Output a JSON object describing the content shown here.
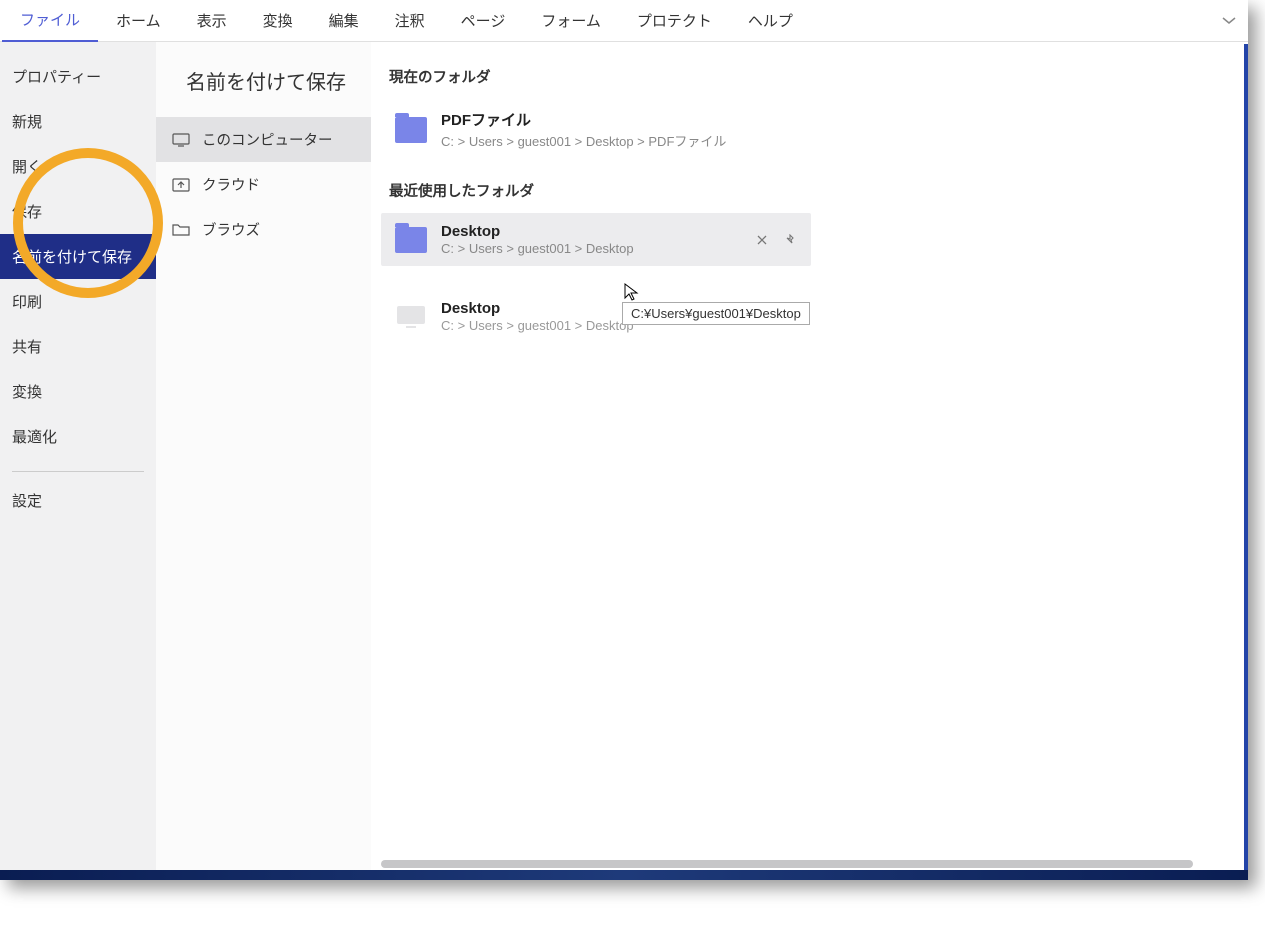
{
  "menu": {
    "items": [
      "ファイル",
      "ホーム",
      "表示",
      "変換",
      "編集",
      "注釈",
      "ページ",
      "フォーム",
      "プロテクト",
      "ヘルプ"
    ],
    "active_index": 0
  },
  "left_sidebar": {
    "items": [
      "プロパティー",
      "新規",
      "開く",
      "保存",
      "名前を付けて保存",
      "印刷",
      "共有",
      "変換",
      "最適化"
    ],
    "selected_index": 4,
    "post_divider_items": [
      "設定"
    ]
  },
  "mid": {
    "title": "名前を付けて保存",
    "items": [
      {
        "label": "このコンピューター",
        "icon": "monitor"
      },
      {
        "label": "クラウド",
        "icon": "cloud-arrow"
      },
      {
        "label": "ブラウズ",
        "icon": "folder-outline"
      }
    ],
    "selected_index": 0
  },
  "right": {
    "current_header": "現在のフォルダ",
    "recent_header": "最近使用したフォルダ",
    "current_folder": {
      "name": "PDFファイル",
      "path": "C: > Users > guest001 > Desktop > PDFファイル"
    },
    "recent_folders": [
      {
        "name": "Desktop",
        "path": "C: > Users > guest001 > Desktop",
        "hovered": true,
        "icon": "blue"
      },
      {
        "name": "Desktop",
        "path": "C: > Users > guest001 > Desktop",
        "hovered": false,
        "icon": "monitor-gray"
      }
    ]
  },
  "tooltip": "C:¥Users¥guest001¥Desktop"
}
